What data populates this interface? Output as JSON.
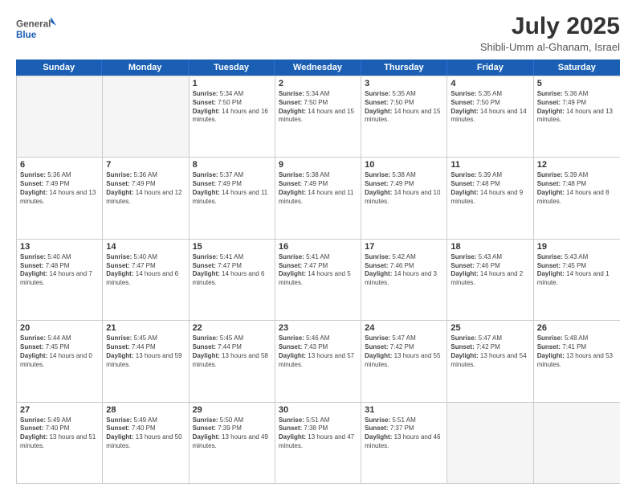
{
  "header": {
    "logo_general": "General",
    "logo_blue": "Blue",
    "month_year": "July 2025",
    "location": "Shibli-Umm al-Ghanam, Israel"
  },
  "weekdays": [
    "Sunday",
    "Monday",
    "Tuesday",
    "Wednesday",
    "Thursday",
    "Friday",
    "Saturday"
  ],
  "weeks": [
    [
      {
        "day": "",
        "empty": true
      },
      {
        "day": "",
        "empty": true
      },
      {
        "day": "1",
        "sunrise": "5:34 AM",
        "sunset": "7:50 PM",
        "daylight": "14 hours and 16 minutes."
      },
      {
        "day": "2",
        "sunrise": "5:34 AM",
        "sunset": "7:50 PM",
        "daylight": "14 hours and 15 minutes."
      },
      {
        "day": "3",
        "sunrise": "5:35 AM",
        "sunset": "7:50 PM",
        "daylight": "14 hours and 15 minutes."
      },
      {
        "day": "4",
        "sunrise": "5:35 AM",
        "sunset": "7:50 PM",
        "daylight": "14 hours and 14 minutes."
      },
      {
        "day": "5",
        "sunrise": "5:36 AM",
        "sunset": "7:49 PM",
        "daylight": "14 hours and 13 minutes."
      }
    ],
    [
      {
        "day": "6",
        "sunrise": "5:36 AM",
        "sunset": "7:49 PM",
        "daylight": "14 hours and 13 minutes."
      },
      {
        "day": "7",
        "sunrise": "5:36 AM",
        "sunset": "7:49 PM",
        "daylight": "14 hours and 12 minutes."
      },
      {
        "day": "8",
        "sunrise": "5:37 AM",
        "sunset": "7:49 PM",
        "daylight": "14 hours and 11 minutes."
      },
      {
        "day": "9",
        "sunrise": "5:38 AM",
        "sunset": "7:49 PM",
        "daylight": "14 hours and 11 minutes."
      },
      {
        "day": "10",
        "sunrise": "5:38 AM",
        "sunset": "7:49 PM",
        "daylight": "14 hours and 10 minutes."
      },
      {
        "day": "11",
        "sunrise": "5:39 AM",
        "sunset": "7:48 PM",
        "daylight": "14 hours and 9 minutes."
      },
      {
        "day": "12",
        "sunrise": "5:39 AM",
        "sunset": "7:48 PM",
        "daylight": "14 hours and 8 minutes."
      }
    ],
    [
      {
        "day": "13",
        "sunrise": "5:40 AM",
        "sunset": "7:48 PM",
        "daylight": "14 hours and 7 minutes."
      },
      {
        "day": "14",
        "sunrise": "5:40 AM",
        "sunset": "7:47 PM",
        "daylight": "14 hours and 6 minutes."
      },
      {
        "day": "15",
        "sunrise": "5:41 AM",
        "sunset": "7:47 PM",
        "daylight": "14 hours and 6 minutes."
      },
      {
        "day": "16",
        "sunrise": "5:41 AM",
        "sunset": "7:47 PM",
        "daylight": "14 hours and 5 minutes."
      },
      {
        "day": "17",
        "sunrise": "5:42 AM",
        "sunset": "7:46 PM",
        "daylight": "14 hours and 3 minutes."
      },
      {
        "day": "18",
        "sunrise": "5:43 AM",
        "sunset": "7:46 PM",
        "daylight": "14 hours and 2 minutes."
      },
      {
        "day": "19",
        "sunrise": "5:43 AM",
        "sunset": "7:45 PM",
        "daylight": "14 hours and 1 minute."
      }
    ],
    [
      {
        "day": "20",
        "sunrise": "5:44 AM",
        "sunset": "7:45 PM",
        "daylight": "14 hours and 0 minutes."
      },
      {
        "day": "21",
        "sunrise": "5:45 AM",
        "sunset": "7:44 PM",
        "daylight": "13 hours and 59 minutes."
      },
      {
        "day": "22",
        "sunrise": "5:45 AM",
        "sunset": "7:44 PM",
        "daylight": "13 hours and 58 minutes."
      },
      {
        "day": "23",
        "sunrise": "5:46 AM",
        "sunset": "7:43 PM",
        "daylight": "13 hours and 57 minutes."
      },
      {
        "day": "24",
        "sunrise": "5:47 AM",
        "sunset": "7:42 PM",
        "daylight": "13 hours and 55 minutes."
      },
      {
        "day": "25",
        "sunrise": "5:47 AM",
        "sunset": "7:42 PM",
        "daylight": "13 hours and 54 minutes."
      },
      {
        "day": "26",
        "sunrise": "5:48 AM",
        "sunset": "7:41 PM",
        "daylight": "13 hours and 53 minutes."
      }
    ],
    [
      {
        "day": "27",
        "sunrise": "5:49 AM",
        "sunset": "7:40 PM",
        "daylight": "13 hours and 51 minutes."
      },
      {
        "day": "28",
        "sunrise": "5:49 AM",
        "sunset": "7:40 PM",
        "daylight": "13 hours and 50 minutes."
      },
      {
        "day": "29",
        "sunrise": "5:50 AM",
        "sunset": "7:39 PM",
        "daylight": "13 hours and 49 minutes."
      },
      {
        "day": "30",
        "sunrise": "5:51 AM",
        "sunset": "7:38 PM",
        "daylight": "13 hours and 47 minutes."
      },
      {
        "day": "31",
        "sunrise": "5:51 AM",
        "sunset": "7:37 PM",
        "daylight": "13 hours and 46 minutes."
      },
      {
        "day": "",
        "empty": true
      },
      {
        "day": "",
        "empty": true
      }
    ]
  ]
}
